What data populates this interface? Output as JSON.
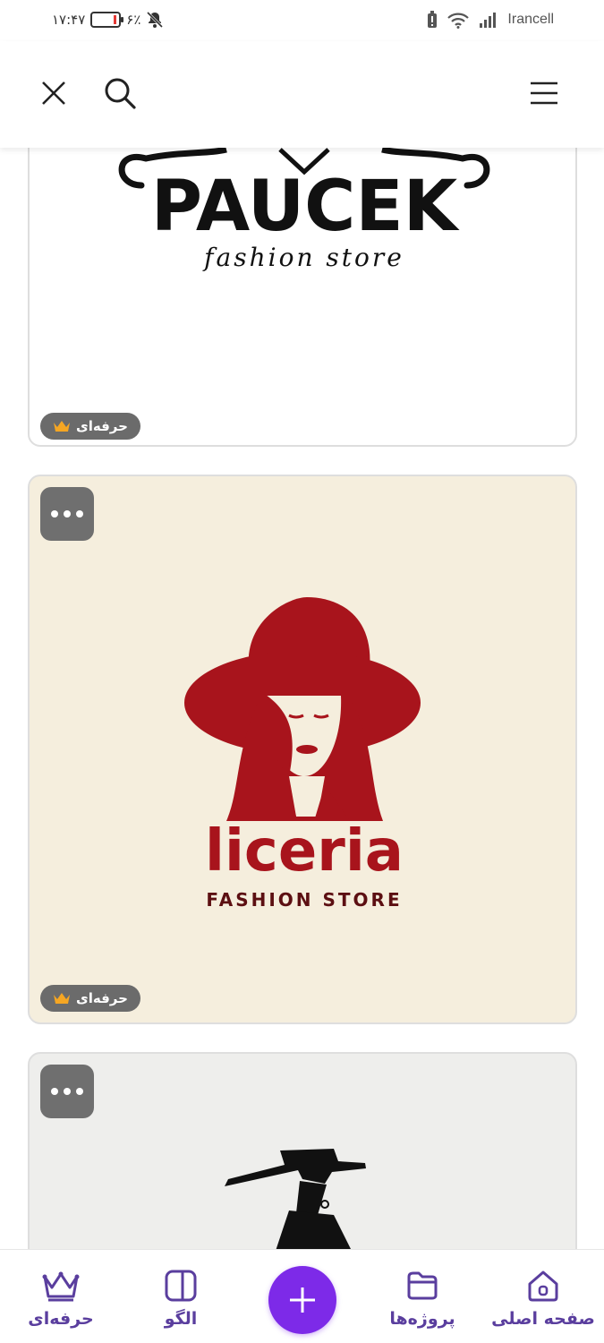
{
  "status_bar": {
    "time": "۱۷:۴۷",
    "battery": "۶٪",
    "carrier": "Irancell"
  },
  "header": {
    "close_icon": "close-icon",
    "search_icon": "search-icon",
    "menu_icon": "hamburger-menu-icon"
  },
  "cards": [
    {
      "logo_brand": "PAUCEK",
      "logo_tagline": "fashion store",
      "badge": "حرفه‌ای",
      "badge_icon": "crown-icon"
    },
    {
      "logo_brand": "liceria",
      "logo_tagline": "FASHION STORE",
      "badge": "حرفه‌ای",
      "badge_icon": "crown-icon",
      "background": "#f5eedd",
      "accent": "#a8141c"
    },
    {
      "background": "#eeeeec"
    }
  ],
  "bottom_nav": {
    "items": [
      {
        "label": "حرفه‌ای",
        "icon": "crown-icon"
      },
      {
        "label": "الگو",
        "icon": "template-icon"
      },
      {
        "label": "پروژه‌ها",
        "icon": "folder-icon"
      },
      {
        "label": "صفحه اصلی",
        "icon": "home-icon"
      }
    ],
    "fab_icon": "plus-icon",
    "accent": "#7d2ae8"
  }
}
